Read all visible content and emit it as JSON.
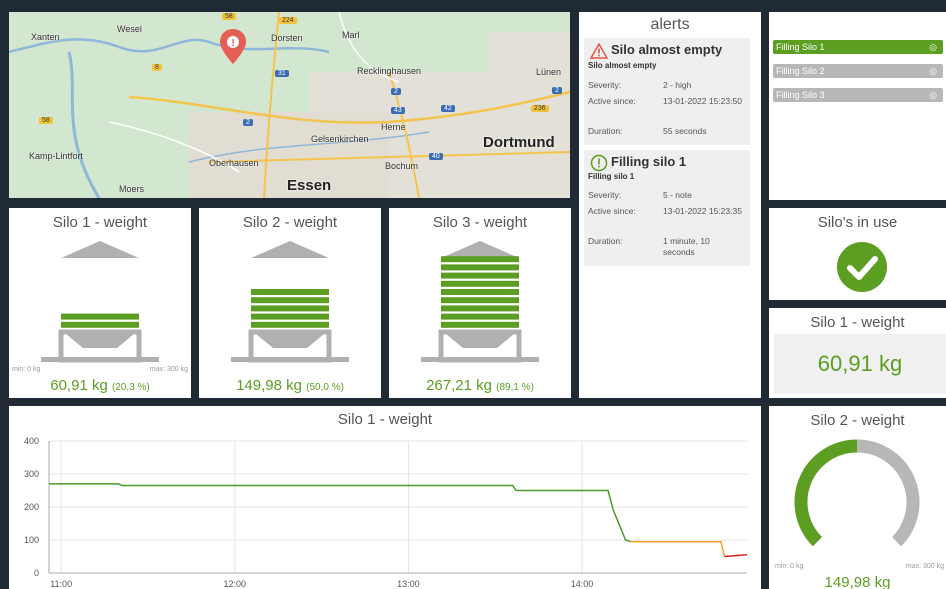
{
  "map": {
    "places": [
      {
        "key": "xanten",
        "label": "Xanten"
      },
      {
        "key": "wesel",
        "label": "Wesel"
      },
      {
        "key": "dorsten",
        "label": "Dorsten"
      },
      {
        "key": "marl",
        "label": "Marl"
      },
      {
        "key": "recklinghausen",
        "label": "Recklinghausen"
      },
      {
        "key": "lunen",
        "label": "Lünen"
      },
      {
        "key": "herne",
        "label": "Herne"
      },
      {
        "key": "gelsenkirchen",
        "label": "Gelsenkirchen"
      },
      {
        "key": "dortmund",
        "label": "Dortmund"
      },
      {
        "key": "kamplintfort",
        "label": "Kamp-Lintfort"
      },
      {
        "key": "oberhausen",
        "label": "Oberhausen"
      },
      {
        "key": "bochum",
        "label": "Bochum"
      },
      {
        "key": "moers",
        "label": "Moers"
      },
      {
        "key": "essen",
        "label": "Essen"
      }
    ],
    "roads": [
      "224",
      "58",
      "8",
      "31",
      "2",
      "43",
      "42",
      "236",
      "2",
      "2",
      "40",
      "58"
    ]
  },
  "silos": [
    {
      "title": "Silo 1 - weight",
      "value": "60,91 kg",
      "percent": "(20,3 %)",
      "fill": 0.203,
      "min": "min: 0 kg",
      "max": "max: 300 kg"
    },
    {
      "title": "Silo 2 - weight",
      "value": "149,98 kg",
      "percent": "(50,0 %)",
      "fill": 0.5,
      "min": "",
      "max": ""
    },
    {
      "title": "Silo 3 - weight",
      "value": "267,21 kg",
      "percent": "(89,1 %)",
      "fill": 0.891,
      "min": "",
      "max": ""
    }
  ],
  "alerts": {
    "title": "alerts",
    "items": [
      {
        "name": "Silo almost empty",
        "sub": "Silo almost empty",
        "severity_label": "Severity:",
        "severity": "2 - high",
        "active_label": "Active since:",
        "active": "13-01-2022 15:23:50",
        "duration_label": "Duration:",
        "duration": "55 seconds",
        "level": "warning",
        "color": "#e0544b"
      },
      {
        "name": "Filling silo 1",
        "sub": "Filling silo 1",
        "severity_label": "Severity:",
        "severity": "5 - note",
        "active_label": "Active since:",
        "active": "13-01-2022 15:23:35",
        "duration_label": "Duration:",
        "duration": "1 minute, 10 seconds",
        "level": "info",
        "color": "#5b9e22"
      }
    ]
  },
  "filling": [
    {
      "label": "Filling Silo 1",
      "active": true
    },
    {
      "label": "Filling Silo 2",
      "active": false
    },
    {
      "label": "Filling Silo 3",
      "active": false
    }
  ],
  "silos_in_use": {
    "title": "Silo's in use"
  },
  "silo1_value": {
    "title": "Silo 1 - weight",
    "value": "60,91 kg"
  },
  "silo2_gauge": {
    "title": "Silo 2 - weight",
    "value": "149,98 kg",
    "fraction": 0.5,
    "min": "min: 0 kg",
    "max": "max: 300 kg"
  },
  "colors": {
    "accent_green": "#5b9e22",
    "inactive_gray": "#b7b7b7",
    "warning_red": "#e0544b",
    "orange": "#f0a020"
  },
  "chart_data": {
    "type": "line",
    "title": "Silo 1 - weight",
    "xlabel": "",
    "ylabel": "",
    "ylim": [
      0,
      400
    ],
    "yticks": [
      "0",
      "100",
      "200",
      "300",
      "400"
    ],
    "xtick_labels": [
      "11:00",
      "12:00",
      "13:00",
      "14:00"
    ],
    "xtick_positions": [
      11.0,
      12.0,
      13.0,
      14.0
    ],
    "xlim": [
      10.93,
      14.95
    ],
    "grid": true,
    "series": [
      {
        "color": "#4a9a2a",
        "x": [
          10.93,
          11.33,
          11.35,
          13.6,
          13.62,
          14.15,
          14.18,
          14.22,
          14.25,
          14.28
        ],
        "y": [
          270,
          270,
          265,
          265,
          250,
          250,
          190,
          140,
          100,
          95
        ]
      },
      {
        "color": "#f0a020",
        "x": [
          14.28,
          14.8,
          14.82
        ],
        "y": [
          95,
          95,
          50
        ]
      },
      {
        "color": "#e0211e",
        "x": [
          14.82,
          14.95
        ],
        "y": [
          50,
          55
        ]
      }
    ]
  }
}
